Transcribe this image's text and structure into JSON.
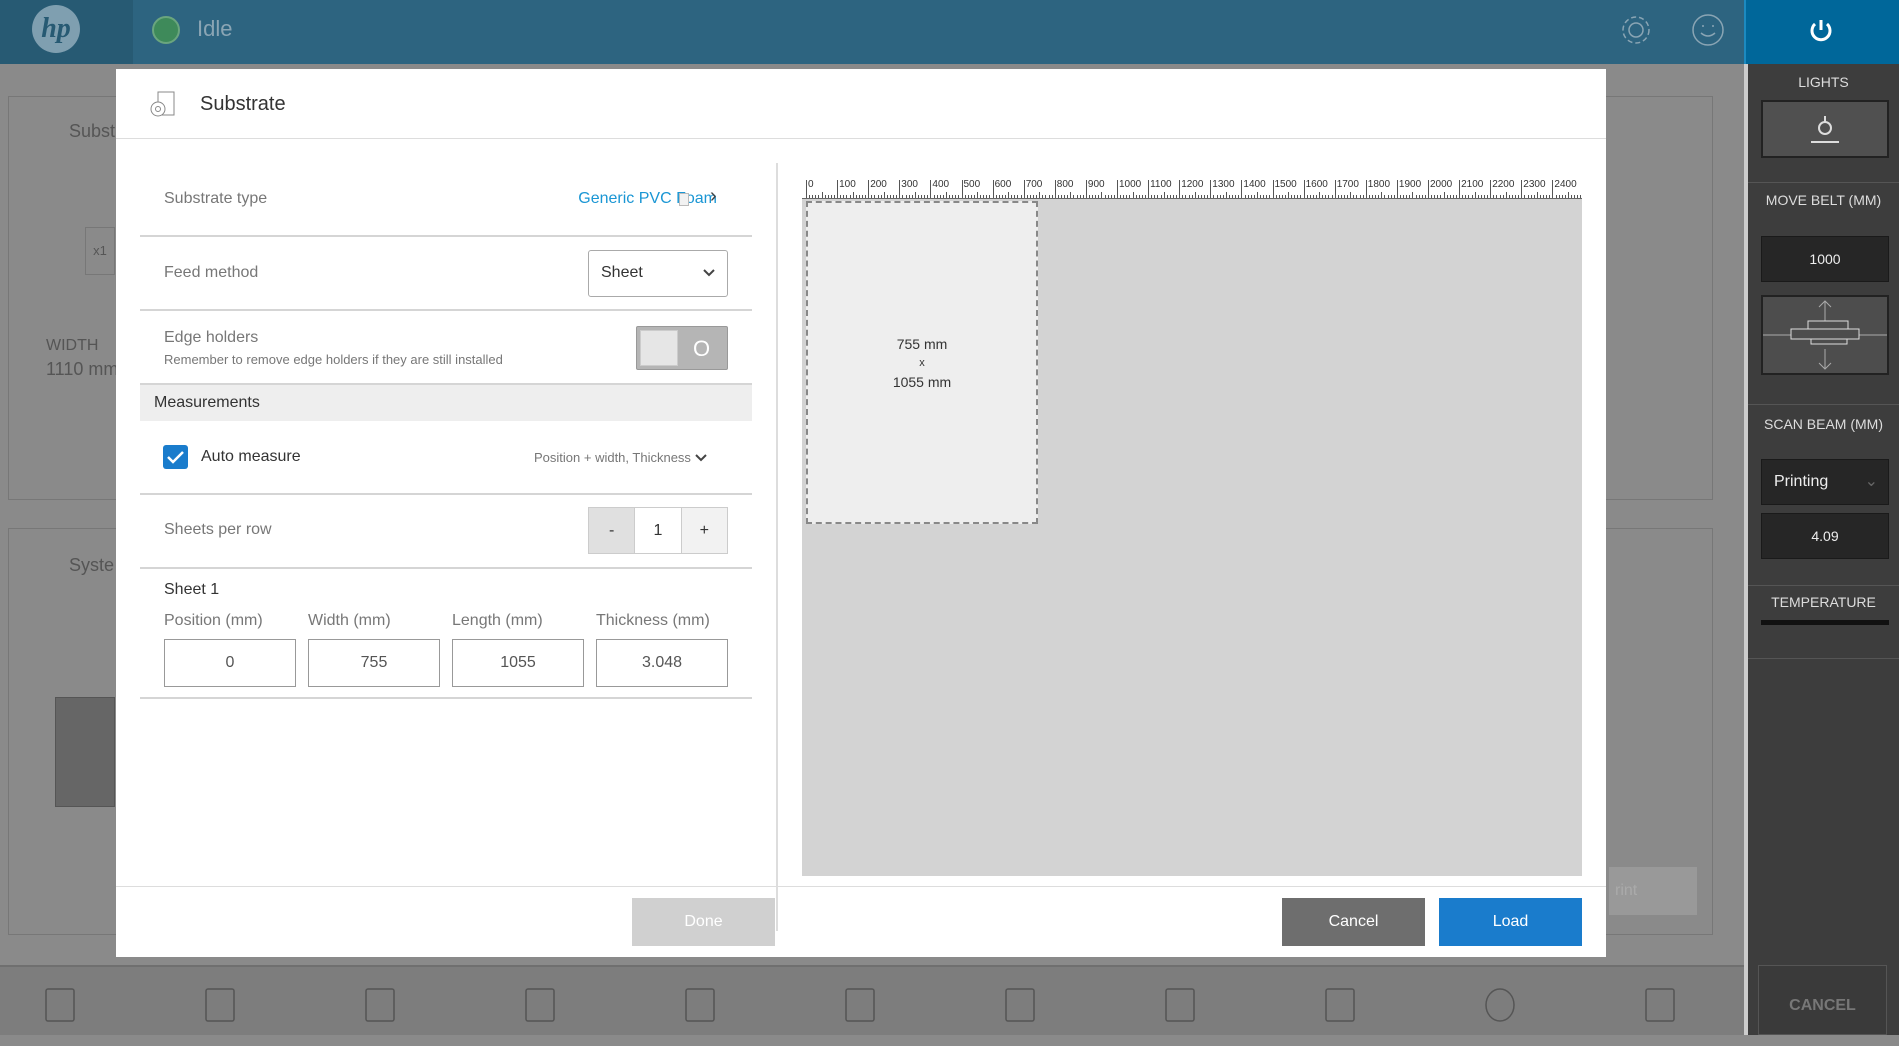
{
  "topbar": {
    "logo": "hp",
    "status": "Idle",
    "status_color": "#3e8a5a",
    "icons": [
      "settings-gear-icon",
      "smiley-feedback-icon",
      "power-icon"
    ]
  },
  "background": {
    "card1_title": "Subst",
    "card1_badge": "x1",
    "width_label": "WIDTH",
    "width_value": "1110 mm",
    "card2_title": "Syste",
    "print_label": "rint"
  },
  "right_panel": {
    "lights": "LIGHTS",
    "move_belt": "MOVE BELT (MM)",
    "move_belt_value": "1000",
    "scan_beam": "SCAN BEAM (MM)",
    "scan_beam_mode": "Printing",
    "scan_beam_value": "4.09",
    "temperature": "TEMPERATURE",
    "cancel": "CANCEL"
  },
  "bottom_bar": {
    "icons": [
      "list-icon",
      "substrate-roll-icon",
      "ink-drop-icon",
      "printhead-icon",
      "printer-icon",
      "circles-icon",
      "cartridge-icon",
      "clipboard-icon",
      "maintenance-wrench-icon",
      "help-icon",
      "location-info-icon"
    ]
  },
  "dialog": {
    "title": "Substrate",
    "substrate_type": {
      "label": "Substrate type",
      "value": "Generic PVC Foam"
    },
    "feed_method": {
      "label": "Feed method",
      "value": "Sheet"
    },
    "edge_holders": {
      "label": "Edge holders",
      "hint": "Remember to remove edge holders if they are still installed",
      "toggle_text": "O",
      "enabled": false
    },
    "measurements": {
      "header": "Measurements",
      "auto_measure": "Auto measure",
      "auto_measure_checked": true,
      "mode": "Position + width, Thickness"
    },
    "sheets_per_row": {
      "label": "Sheets per row",
      "minus": "-",
      "value": "1",
      "plus": "+"
    },
    "sheet": {
      "title": "Sheet 1",
      "fields": [
        {
          "label": "Position (mm)",
          "value": "0"
        },
        {
          "label": "Width (mm)",
          "value": "755"
        },
        {
          "label": "Length (mm)",
          "value": "1055"
        },
        {
          "label": "Thickness (mm)",
          "value": "3.048"
        }
      ]
    },
    "preview": {
      "ruler": [
        "0",
        "100",
        "200",
        "300",
        "400",
        "500",
        "600",
        "700",
        "800",
        "900",
        "1000",
        "1100",
        "1200",
        "1300",
        "1400",
        "1500",
        "1600",
        "1700",
        "1800",
        "1900",
        "2000",
        "2100",
        "2200",
        "2300",
        "2400"
      ],
      "sheet_width": "755 mm",
      "sheet_x": "x",
      "sheet_length": "1055 mm"
    },
    "buttons": {
      "done": "Done",
      "cancel": "Cancel",
      "load": "Load"
    },
    "accent": "#1a7ccc"
  }
}
